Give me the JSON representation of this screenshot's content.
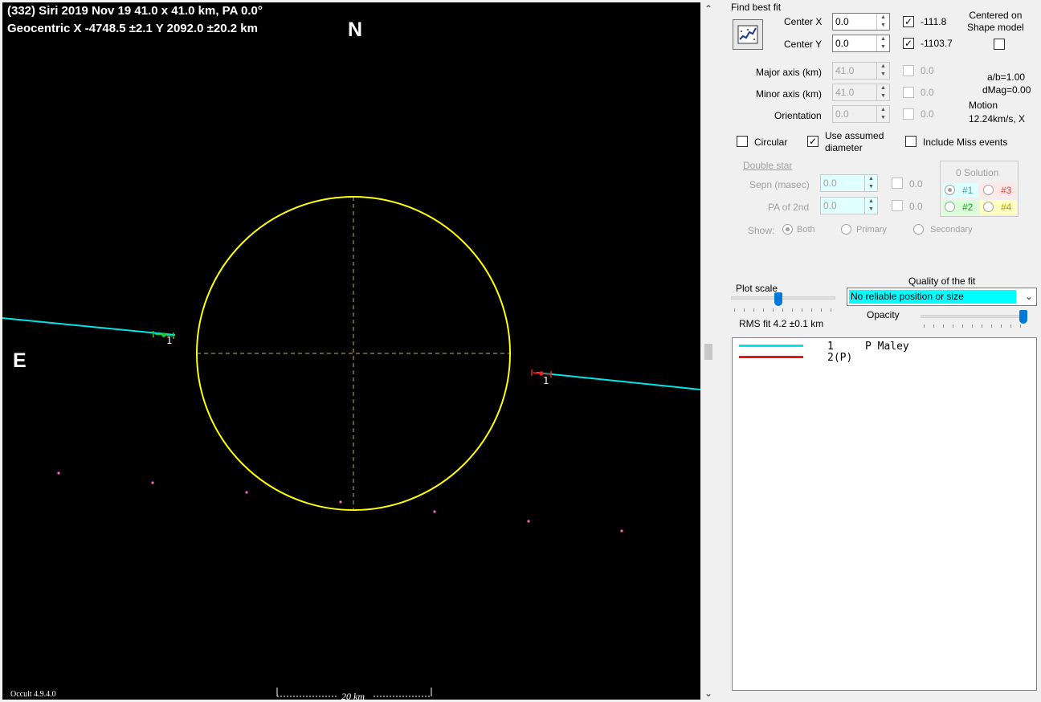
{
  "plot": {
    "title_line1": "(332) Siri  2019 Nov 19  41.0 x 41.0 km, PA 0.0°",
    "title_line2": "Geocentric  X  -4748.5 ±2.1  Y 2092.0 ±20.2 km",
    "north_label": "N",
    "east_label": "E",
    "version": "Occult 4.9.4.0",
    "scale_label": "20 km",
    "chord_label_left": "1",
    "chord_label_right": "1",
    "colors": {
      "ellipse": "#ffff00",
      "chord": "#00e5e5",
      "dots": "#ff66cc"
    }
  },
  "panel": {
    "find_best_fit": "Find best fit",
    "center_x_label": "Center X",
    "center_x_value": "0.0",
    "center_x_fit": "-111.8",
    "center_y_label": "Center Y",
    "center_y_value": "0.0",
    "center_y_fit": "-1103.7",
    "centered_on_label": "Centered on\nShape model",
    "major_axis_label": "Major axis (km)",
    "major_axis_value": "41.0",
    "major_axis_fit": "0.0",
    "minor_axis_label": "Minor axis (km)",
    "minor_axis_value": "41.0",
    "minor_axis_fit": "0.0",
    "orientation_label": "Orientation",
    "orientation_value": "0.0",
    "orientation_fit": "0.0",
    "ab_ratio": "a/b=1.00",
    "dmag": "dMag=0.00",
    "motion_label": "Motion",
    "motion_value": "12.24km/s, X",
    "circular_label": "Circular",
    "use_assumed_label": "Use assumed\ndiameter",
    "include_miss_label": "Include Miss events",
    "double_star_label": "Double star",
    "sepn_label": "Sepn (masec)",
    "sepn_value": "0.0",
    "sepn_fit": "0.0",
    "pa2_label": "PA of 2nd",
    "pa2_value": "0.0",
    "pa2_fit": "0.0",
    "show_label": "Show:",
    "show_both": "Both",
    "show_primary": "Primary",
    "show_secondary": "Secondary",
    "solution_group": "0 Solution",
    "sol1": "#1",
    "sol2": "#2",
    "sol3": "#3",
    "sol4": "#4",
    "plot_scale_label": "Plot scale",
    "quality_label": "Quality of the fit",
    "quality_value": "No reliable position or size",
    "opacity_label": "Opacity",
    "rms_fit": "RMS fit 4.2 ±0.1 km",
    "legend": [
      {
        "text": "1     P Maley",
        "color": "#00e5e5"
      },
      {
        "text": "2(P)",
        "color": "#ee1111"
      }
    ]
  }
}
